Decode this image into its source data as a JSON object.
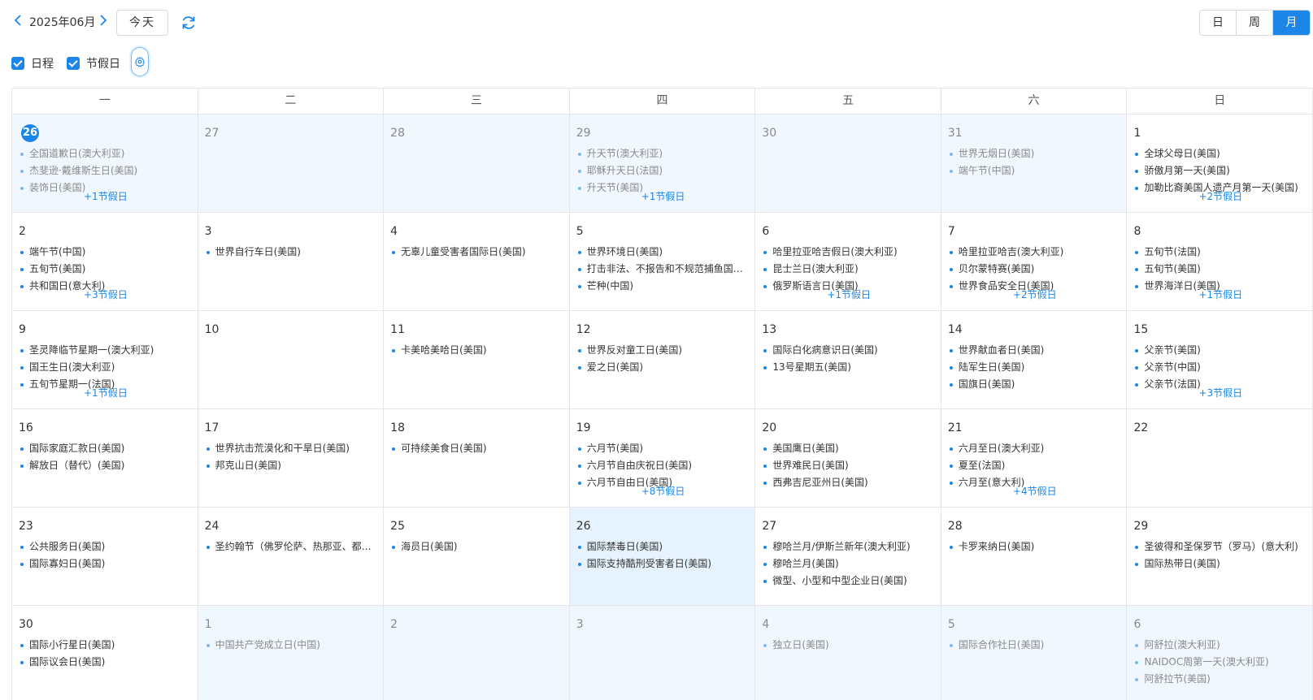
{
  "toolbar": {
    "month_label": "2025年06月",
    "today_label": "今天",
    "views": [
      {
        "label": "日",
        "active": false
      },
      {
        "label": "周",
        "active": false
      },
      {
        "label": "月",
        "active": true
      }
    ],
    "accent_color": "#1b86e8"
  },
  "filters": {
    "schedule_label": "日程",
    "holiday_label": "节假日"
  },
  "weekdays": [
    "一",
    "二",
    "三",
    "四",
    "五",
    "六",
    "日"
  ],
  "weeks": [
    [
      {
        "day": "26",
        "other": true,
        "today": true,
        "events": [
          "全国道歉日(澳大利亚)",
          "杰斐逊·戴维斯生日(美国)",
          "装饰日(美国)"
        ],
        "more": "+1节假日"
      },
      {
        "day": "27",
        "other": true,
        "events": []
      },
      {
        "day": "28",
        "other": true,
        "events": []
      },
      {
        "day": "29",
        "other": true,
        "events": [
          "升天节(澳大利亚)",
          "耶稣升天日(法国)",
          "升天节(美国)"
        ],
        "more": "+1节假日"
      },
      {
        "day": "30",
        "other": true,
        "events": []
      },
      {
        "day": "31",
        "other": true,
        "events": [
          "世界无烟日(美国)",
          "端午节(中国)"
        ]
      },
      {
        "day": "1",
        "events": [
          "全球父母日(美国)",
          "骄傲月第一天(美国)",
          "加勒比裔美国人遗产月第一天(美国)"
        ],
        "more": "+2节假日"
      }
    ],
    [
      {
        "day": "2",
        "events": [
          "端午节(中国)",
          "五旬节(美国)",
          "共和国日(意大利)"
        ],
        "more": "+3节假日"
      },
      {
        "day": "3",
        "events": [
          "世界自行车日(美国)"
        ]
      },
      {
        "day": "4",
        "events": [
          "无辜儿童受害者国际日(美国)"
        ]
      },
      {
        "day": "5",
        "events": [
          "世界环境日(美国)",
          "打击非法、不报告和不规范捕鱼国际日(美国)",
          "芒种(中国)"
        ]
      },
      {
        "day": "6",
        "events": [
          "哈里拉亚哈吉假日(澳大利亚)",
          "昆士兰日(澳大利亚)",
          "俄罗斯语言日(美国)"
        ],
        "more": "+1节假日"
      },
      {
        "day": "7",
        "events": [
          "哈里拉亚哈吉(澳大利亚)",
          "贝尔蒙特赛(美国)",
          "世界食品安全日(美国)"
        ],
        "more": "+2节假日"
      },
      {
        "day": "8",
        "events": [
          "五旬节(法国)",
          "五旬节(美国)",
          "世界海洋日(美国)"
        ],
        "more": "+1节假日"
      }
    ],
    [
      {
        "day": "9",
        "events": [
          "圣灵降临节星期一(澳大利亚)",
          "国王生日(澳大利亚)",
          "五旬节星期一(法国)"
        ],
        "more": "+1节假日"
      },
      {
        "day": "10",
        "events": []
      },
      {
        "day": "11",
        "events": [
          "卡美哈美哈日(美国)"
        ]
      },
      {
        "day": "12",
        "events": [
          "世界反对童工日(美国)",
          "爱之日(美国)"
        ]
      },
      {
        "day": "13",
        "events": [
          "国际白化病意识日(美国)",
          "13号星期五(美国)"
        ]
      },
      {
        "day": "14",
        "events": [
          "世界献血者日(美国)",
          "陆军生日(美国)",
          "国旗日(美国)"
        ]
      },
      {
        "day": "15",
        "events": [
          "父亲节(美国)",
          "父亲节(中国)",
          "父亲节(法国)"
        ],
        "more": "+3节假日"
      }
    ],
    [
      {
        "day": "16",
        "events": [
          "国际家庭汇款日(美国)",
          "解放日（替代）(美国)"
        ]
      },
      {
        "day": "17",
        "events": [
          "世界抗击荒漠化和干旱日(美国)",
          "邦克山日(美国)"
        ]
      },
      {
        "day": "18",
        "events": [
          "可持续美食日(美国)"
        ]
      },
      {
        "day": "19",
        "events": [
          "六月节(美国)",
          "六月节自由庆祝日(美国)",
          "六月节自由日(美国)"
        ],
        "more": "+8节假日"
      },
      {
        "day": "20",
        "events": [
          "美国鹰日(美国)",
          "世界难民日(美国)",
          "西弗吉尼亚州日(美国)"
        ]
      },
      {
        "day": "21",
        "events": [
          "六月至日(澳大利亚)",
          "夏至(法国)",
          "六月至(意大利)"
        ],
        "more": "+4节假日"
      },
      {
        "day": "22",
        "events": []
      }
    ],
    [
      {
        "day": "23",
        "events": [
          "公共服务日(美国)",
          "国际寡妇日(美国)"
        ]
      },
      {
        "day": "24",
        "events": [
          "圣约翰节（佛罗伦萨、热那亚、都灵）(意大利)"
        ]
      },
      {
        "day": "25",
        "events": [
          "海员日(美国)"
        ]
      },
      {
        "day": "26",
        "highlight": true,
        "events": [
          "国际禁毒日(美国)",
          "国际支持酷刑受害者日(美国)"
        ]
      },
      {
        "day": "27",
        "events": [
          "穆哈兰月/伊斯兰新年(澳大利亚)",
          "穆哈兰月(美国)",
          "微型、小型和中型企业日(美国)"
        ]
      },
      {
        "day": "28",
        "events": [
          "卡罗来纳日(美国)"
        ]
      },
      {
        "day": "29",
        "events": [
          "圣彼得和圣保罗节（罗马）(意大利)",
          "国际热带日(美国)"
        ]
      }
    ],
    [
      {
        "day": "30",
        "events": [
          "国际小行星日(美国)",
          "国际议会日(美国)"
        ]
      },
      {
        "day": "1",
        "other": true,
        "events": [
          "中国共产党成立日(中国)"
        ]
      },
      {
        "day": "2",
        "other": true,
        "events": []
      },
      {
        "day": "3",
        "other": true,
        "events": []
      },
      {
        "day": "4",
        "other": true,
        "events": [
          "独立日(美国)"
        ]
      },
      {
        "day": "5",
        "other": true,
        "events": [
          "国际合作社日(美国)"
        ]
      },
      {
        "day": "6",
        "other": true,
        "events": [
          "阿舒拉(澳大利亚)",
          "NAIDOC周第一天(澳大利亚)",
          "阿舒拉节(美国)"
        ]
      }
    ]
  ]
}
